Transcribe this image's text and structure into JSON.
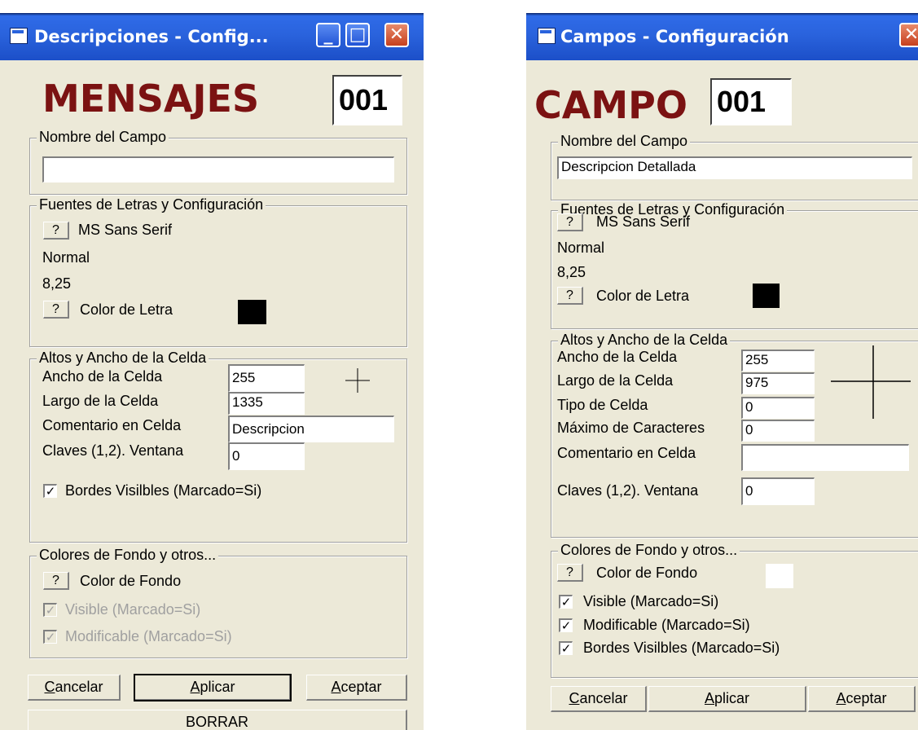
{
  "left": {
    "title": "Descripciones - Config...",
    "heading": "MENSAJES",
    "number": "001",
    "nombre_group": "Nombre del Campo",
    "nombre_value": "",
    "fuentes_group": "Fuentes de Letras y Configuración",
    "font_button": "?",
    "font_name": "MS Sans Serif",
    "font_style": "Normal",
    "font_size": "8,25",
    "color_button": "?",
    "color_label": "Color de Letra",
    "color_letra": "#000000",
    "altos_group": "Altos y Ancho de la Celda",
    "ancho_label": "Ancho de la Celda",
    "ancho_value": "255",
    "largo_label": "Largo de la Celda",
    "largo_value": "1335",
    "comentario_label": "Comentario en Celda",
    "comentario_value": "Descripcion",
    "claves_label": "Claves (1,2). Ventana",
    "claves_value": "0",
    "bordes_label": "Bordes Visilbles (Marcado=Si)",
    "colores_group": "Colores de Fondo y otros...",
    "fondo_button": "?",
    "fondo_label": "Color de Fondo",
    "visible_label": "Visible (Marcado=Si)",
    "modificable_label": "Modificable (Marcado=Si)",
    "cancel": "Cancelar",
    "apply": "Aplicar",
    "accept": "Aceptar",
    "delete": "BORRAR"
  },
  "right": {
    "title": "Campos - Configuración",
    "heading": "CAMPO",
    "number": "001",
    "nombre_group": "Nombre del Campo",
    "nombre_value": "Descripcion Detallada",
    "fuentes_group": "Fuentes de Letras y Configuración",
    "font_button": "?",
    "font_name": "MS Sans Serif",
    "font_style": "Normal",
    "font_size": "8,25",
    "color_button": "?",
    "color_label": "Color de Letra",
    "color_letra": "#000000",
    "altos_group": "Altos y Ancho de la Celda",
    "ancho_label": "Ancho de la Celda",
    "ancho_value": "255",
    "largo_label": "Largo de la Celda",
    "largo_value": "975",
    "tipo_label": "Tipo de Celda",
    "tipo_value": "0",
    "maximo_label": "Máximo de Caracteres",
    "maximo_value": "0",
    "comentario_label": "Comentario en Celda",
    "comentario_value": "",
    "claves_label": "Claves (1,2). Ventana",
    "claves_value": "0",
    "colores_group": "Colores de Fondo y otros...",
    "fondo_button": "?",
    "fondo_label": "Color de Fondo",
    "color_fondo": "#ffffff",
    "visible_label": "Visible (Marcado=Si)",
    "modificable_label": "Modificable (Marcado=Si)",
    "bordes_label": "Bordes Visilbles (Marcado=Si)",
    "cancel": "Cancelar",
    "apply": "Aplicar",
    "accept": "Aceptar"
  }
}
